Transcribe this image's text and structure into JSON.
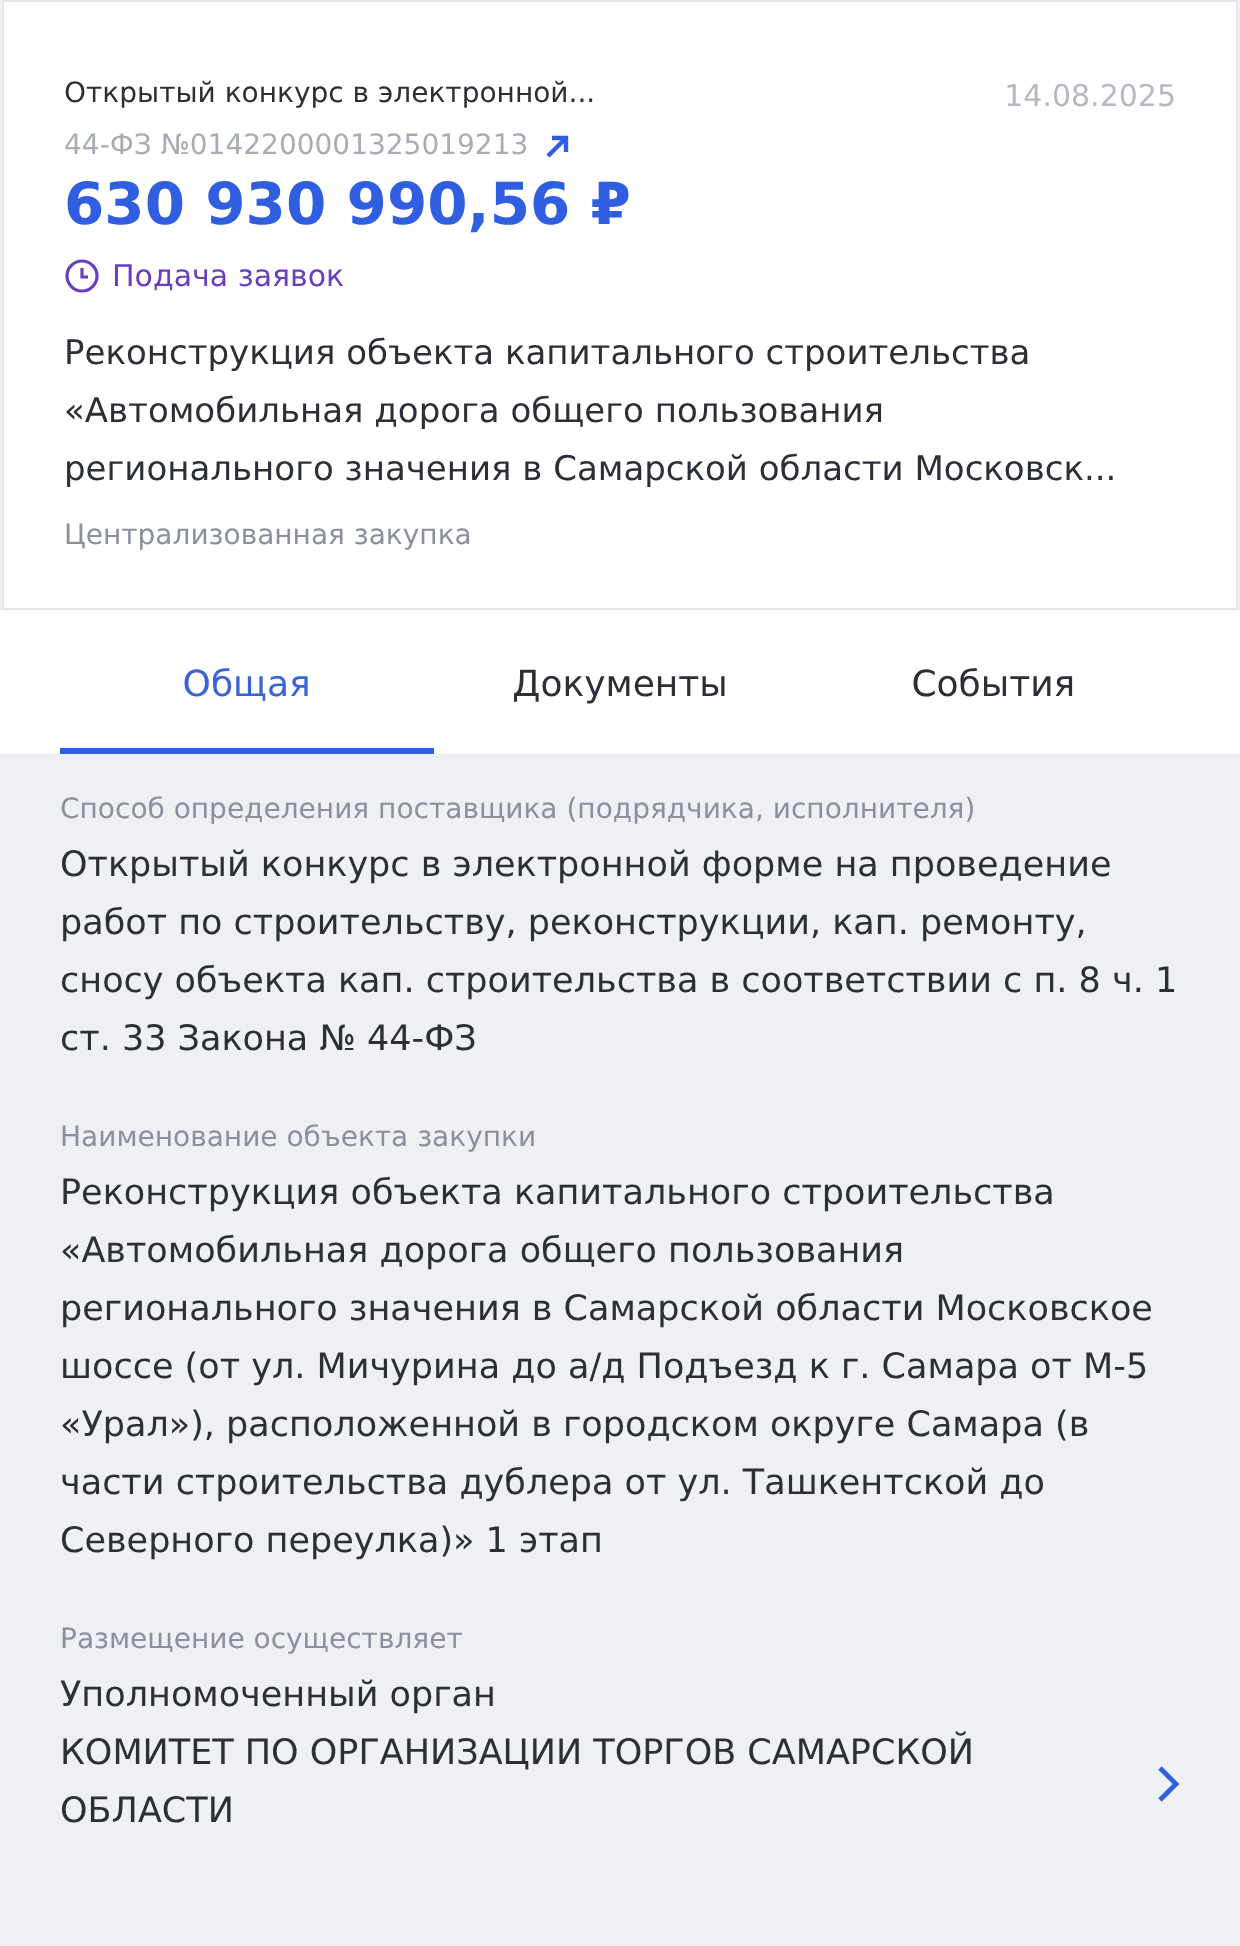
{
  "card": {
    "procedure": "Открытый конкурс в электронной...",
    "date": "14.08.2025",
    "number": "44-ФЗ №0142200001325019213",
    "amount": "630 930 990,56 ₽",
    "status": "Подача заявок",
    "title_lines": [
      "Реконструкция объекта капитального строительства",
      "«Автомобильная дорога общего пользования",
      "регионального значения в Самарской области Московск..."
    ],
    "note": "Централизованная закупка"
  },
  "tabs": [
    {
      "label": "Общая",
      "selected": true
    },
    {
      "label": "Документы",
      "selected": false
    },
    {
      "label": "События",
      "selected": false
    }
  ],
  "fields": [
    {
      "label": "Способ определения поставщика (подрядчика, исполнителя)",
      "value": "Открытый конкурс в электронной форме на проведение работ по строительству, реконструкции, кап. ремонту, сносу объекта кап. строительства в соответствии с п. 8 ч. 1 ст. 33 Закона № 44-ФЗ"
    },
    {
      "label": "Наименование объекта закупки",
      "value": "Реконструкция объекта капитального строительства «Автомобильная дорога общего пользования регионального значения в Самарской области Московское шоссе (от ул. Мичурина до а/д Подъезд к г. Самара от М-5 «Урал»), расположенной в городском округе Самара (в части строительства дублера от ул. Ташкентской до Северного переулка)» 1 этап"
    },
    {
      "label": "Размещение осуществляет",
      "role": "Уполномоченный орган",
      "value": "КОМИТЕТ ПО ОРГАНИЗАЦИИ ТОРГОВ САМАРСКОЙ ОБЛАСТИ",
      "link": true
    }
  ]
}
